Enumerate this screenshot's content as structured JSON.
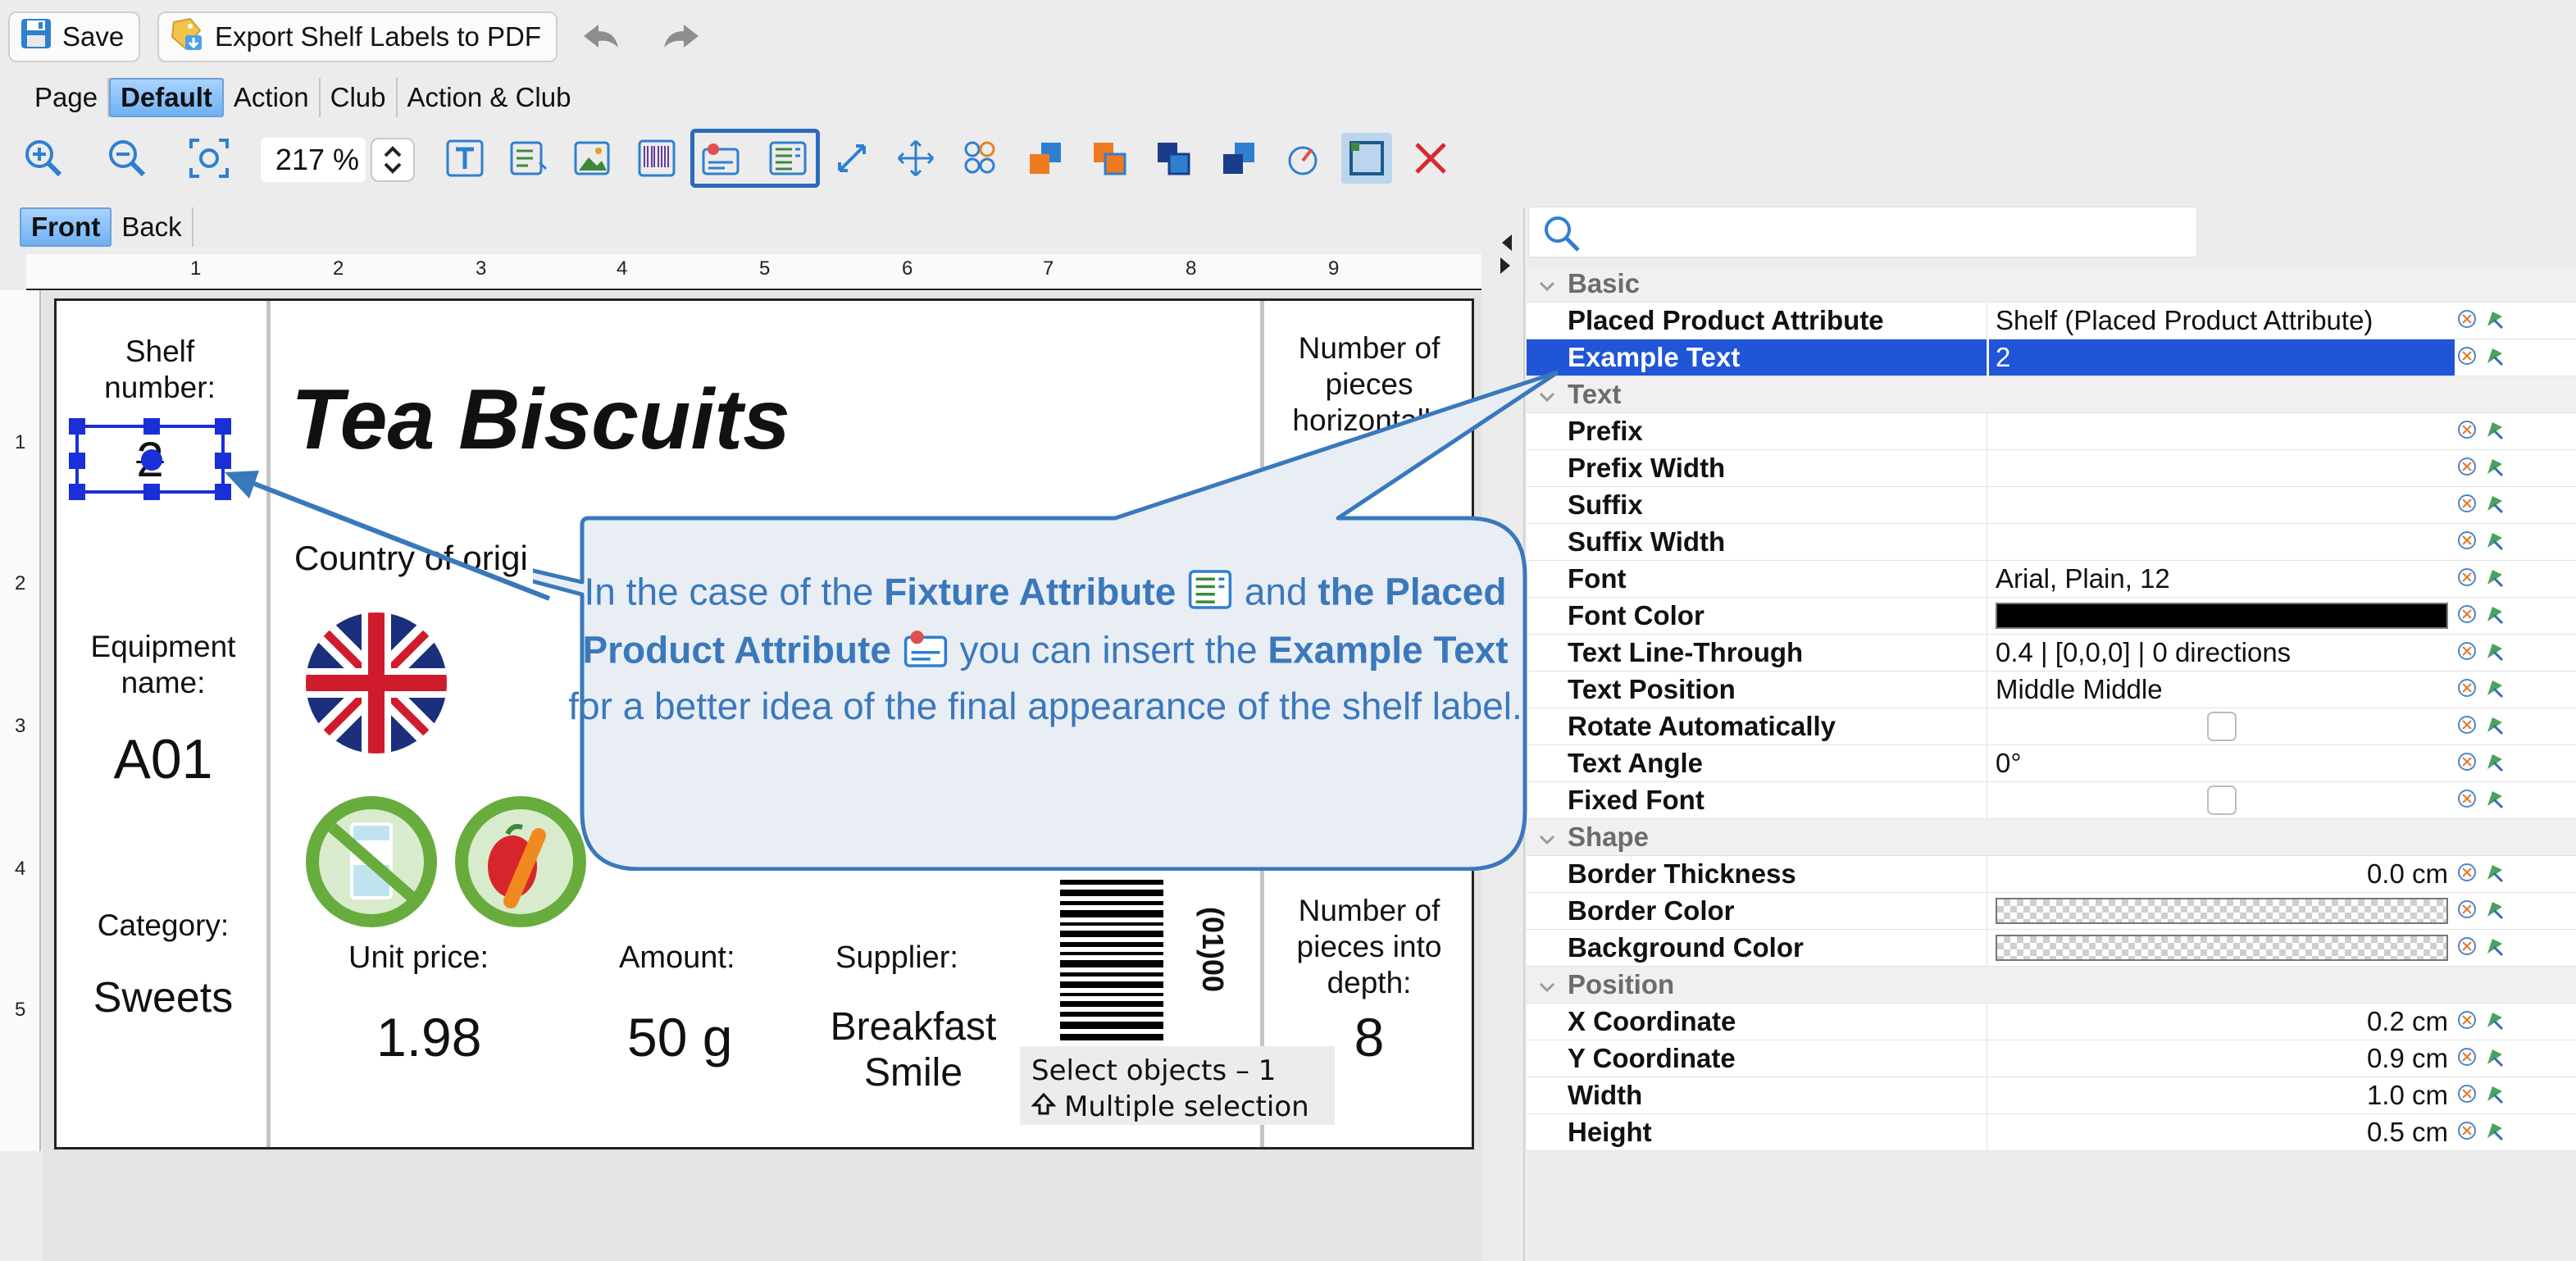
{
  "toolbar": {
    "save_label": "Save",
    "export_label": "Export Shelf Labels to PDF"
  },
  "tabs": [
    "Page",
    "Default",
    "Action",
    "Club",
    "Action & Club"
  ],
  "selected_tab": "Default",
  "zoom": "217 %",
  "side_tabs": [
    "Front",
    "Back"
  ],
  "selected_side": "Front",
  "ruler_top": [
    "1",
    "2",
    "3",
    "4",
    "5",
    "6",
    "7",
    "8",
    "9"
  ],
  "ruler_left": [
    "1",
    "2",
    "3",
    "4",
    "5"
  ],
  "label": {
    "shelf_caption": "Shelf number:",
    "shelf_value": "2",
    "equipment_caption": "Equipment name:",
    "equipment_value": "A01",
    "category_caption": "Category:",
    "category_value": "Sweets",
    "product_title": "Tea Biscuits",
    "country_caption": "Country of origi",
    "unit_price_caption": "Unit price:",
    "unit_price_value": "1.98",
    "amount_caption": "Amount:",
    "amount_value": "50 g",
    "supplier_caption": "Supplier:",
    "supplier_value": "Breakfast Smile",
    "barcode_text": "(01)00",
    "pieces_h_caption": "Number of pieces horizontally",
    "pieces_d_caption": "Number of pieces into depth:",
    "pieces_d_value": "8"
  },
  "status": {
    "select_objects": "Select objects – 1",
    "multiple_selection": "Multiple selection"
  },
  "properties": [
    {
      "type": "category",
      "name": "Basic"
    },
    {
      "type": "row",
      "name": "Placed Product Attribute",
      "value": "Shelf (Placed Product Attribute)"
    },
    {
      "type": "row",
      "name": "Example Text",
      "value": "2",
      "selected": true
    },
    {
      "type": "category",
      "name": "Text"
    },
    {
      "type": "row",
      "name": "Prefix",
      "value": ""
    },
    {
      "type": "row",
      "name": "Prefix Width",
      "value": ""
    },
    {
      "type": "row",
      "name": "Suffix",
      "value": ""
    },
    {
      "type": "row",
      "name": "Suffix Width",
      "value": ""
    },
    {
      "type": "row",
      "name": "Font",
      "value": "Arial, Plain, 12"
    },
    {
      "type": "row",
      "name": "Font Color",
      "value": "",
      "swatch": "#000000"
    },
    {
      "type": "row",
      "name": "Text Line-Through",
      "value": "0.4 | [0,0,0] | 0 directions"
    },
    {
      "type": "row",
      "name": "Text Position",
      "value": "Middle Middle"
    },
    {
      "type": "row",
      "name": "Rotate Automatically",
      "value": "",
      "checkbox": true
    },
    {
      "type": "row",
      "name": "Text Angle",
      "value": "0°"
    },
    {
      "type": "row",
      "name": "Fixed Font",
      "value": "",
      "checkbox": true
    },
    {
      "type": "category",
      "name": "Shape"
    },
    {
      "type": "row",
      "name": "Border Thickness",
      "value": "0.0 cm",
      "align": "right"
    },
    {
      "type": "row",
      "name": "Border Color",
      "value": "",
      "swatch": "transparent"
    },
    {
      "type": "row",
      "name": "Background Color",
      "value": "",
      "swatch": "transparent"
    },
    {
      "type": "category",
      "name": "Position"
    },
    {
      "type": "row",
      "name": "X Coordinate",
      "value": "0.2 cm",
      "align": "right"
    },
    {
      "type": "row",
      "name": "Y Coordinate",
      "value": "0.9 cm",
      "align": "right"
    },
    {
      "type": "row",
      "name": "Width",
      "value": "1.0 cm",
      "align": "right"
    },
    {
      "type": "row",
      "name": "Height",
      "value": "0.5 cm",
      "align": "right"
    }
  ],
  "callout": {
    "p1": "In the case of the ",
    "b1": "Fixture Attribute",
    "p2": " and ",
    "b2": "the Placed Product Attribute",
    "p3": " you can insert the ",
    "b3": "Example Text",
    "p4": " for a better idea of the final appearance of the shelf label."
  },
  "colors": {
    "accent": "#1f55d6",
    "callout_text": "#3a78bc",
    "callout_border": "#3a78bc",
    "callout_fill": "#e9eef5",
    "selection": "#1a2fd8",
    "delete": "#d8292f"
  }
}
